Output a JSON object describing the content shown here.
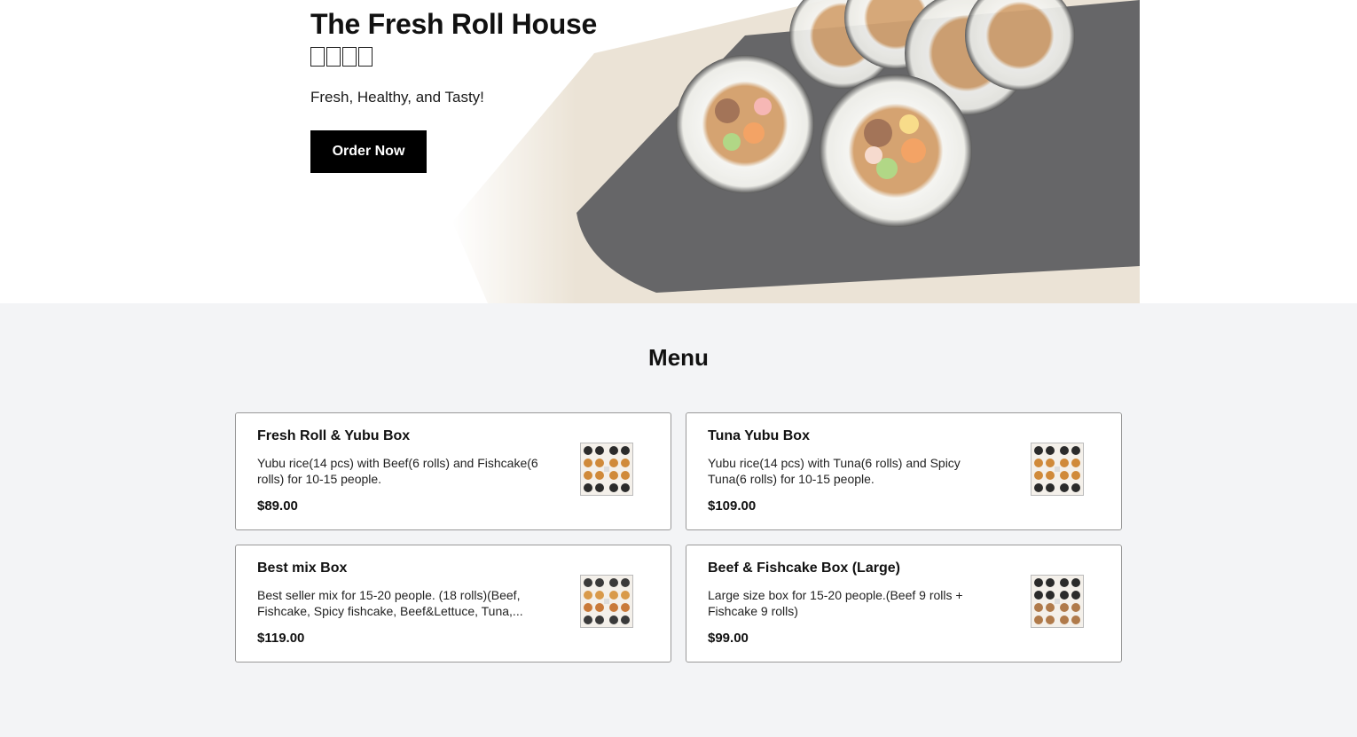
{
  "hero": {
    "title": "The Fresh Roll House",
    "korean_name": "□□□□",
    "tagline": "Fresh, Healthy, and Tasty!",
    "order_button": "Order Now"
  },
  "menu": {
    "title": "Menu",
    "items": [
      {
        "name": "Fresh Roll & Yubu Box",
        "description": "Yubu rice(14 pcs) with Beef(6 rolls) and Fishcake(6 rolls) for 10-15 people.",
        "price": "$89.00"
      },
      {
        "name": "Tuna Yubu Box",
        "description": "Yubu rice(14 pcs) with Tuna(6 rolls) and Spicy Tuna(6 rolls) for 10-15 people.",
        "price": "$109.00"
      },
      {
        "name": "Best mix Box",
        "description": "Best seller mix for 15-20 people. (18 rolls)(Beef, Fishcake, Spicy fishcake, Beef&Lettuce, Tuna,...",
        "price": "$119.00"
      },
      {
        "name": "Beef & Fishcake Box (Large)",
        "description": "Large size box for 15-20 people.(Beef 9 rolls + Fishcake 9 rolls)",
        "price": "$99.00"
      }
    ]
  }
}
